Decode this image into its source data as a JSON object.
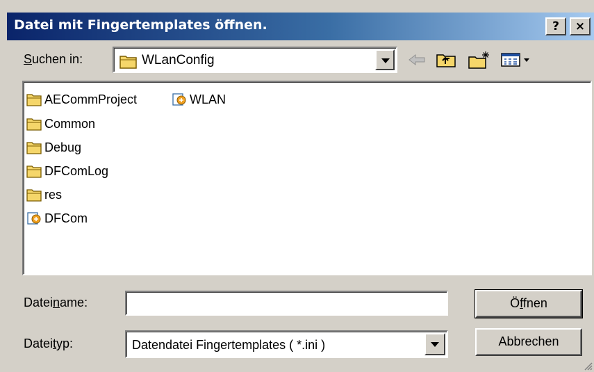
{
  "window": {
    "title": "Datei mit Fingertemplates öffnen.",
    "help_label": "?",
    "close_label": "×"
  },
  "lookin": {
    "label_pre": "",
    "label_accel": "S",
    "label_post": "uchen in:",
    "value": "WLanConfig"
  },
  "toolbar": {
    "back_icon": "back-arrow-icon",
    "up_icon": "up-folder-icon",
    "new_folder_icon": "new-folder-icon",
    "view_menu_icon": "view-menu-icon"
  },
  "files": [
    {
      "name": "AECommProject",
      "type": "folder"
    },
    {
      "name": "Common",
      "type": "folder"
    },
    {
      "name": "Debug",
      "type": "folder"
    },
    {
      "name": "DFComLog",
      "type": "folder"
    },
    {
      "name": "res",
      "type": "folder"
    },
    {
      "name": "DFCom",
      "type": "project"
    },
    {
      "name": "WLAN",
      "type": "project"
    }
  ],
  "filename": {
    "label_pre": "Datei",
    "label_accel": "n",
    "label_post": "ame:",
    "value": "",
    "placeholder": ""
  },
  "filetype": {
    "label_pre": "Datei",
    "label_accel": "t",
    "label_post": "yp:",
    "value": "Datendatei Fingertemplates ( *.ini )"
  },
  "buttons": {
    "open_pre": "Ö",
    "open_accel": "f",
    "open_post": "fnen",
    "cancel": "Abbrechen"
  },
  "colors": {
    "titlebar_start": "#0a246a",
    "titlebar_end": "#a6caf0",
    "face": "#d4d0c8",
    "folder_yellow": "#f5d66a"
  }
}
